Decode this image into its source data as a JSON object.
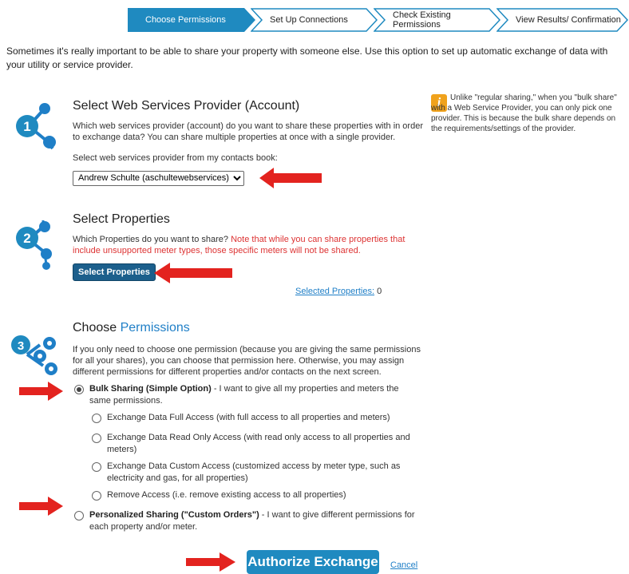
{
  "steps": [
    {
      "label": "Choose Permissions",
      "active": true
    },
    {
      "label": "Set Up Connections",
      "active": false
    },
    {
      "label": "Check Existing Permissions",
      "active": false
    },
    {
      "label": "View Results/ Confirmation",
      "active": false
    }
  ],
  "intro": "Sometimes it's really important to be able to share your property with someone else. Use this option to set up automatic exchange of data with your utility or service provider.",
  "section1": {
    "title": "Select Web Services Provider (Account)",
    "desc": "Which web services provider (account) do you want to share these properties with in order to exchange data? You can share multiple properties at once with a single provider.",
    "select_label": "Select web services provider from my contacts book:",
    "select_value": "Andrew Schulte (aschultewebservices)",
    "step_number": "1"
  },
  "note": {
    "icon": "info-icon",
    "text": "Unlike \"regular sharing,\" when you \"bulk share\" with a Web Service Provider, you can only pick one provider. This is because the bulk share depends on the requirements/settings of the provider."
  },
  "section2": {
    "title": "Select Properties",
    "desc": "Which Properties do you want to share?",
    "warning": "Note that while you can share properties that include unsupported meter types, those specific meters will not be shared.",
    "button": "Select Properties",
    "selected_label": "Selected Properties:",
    "selected_count": "0",
    "step_number": "2"
  },
  "section3": {
    "title_plain": "Choose",
    "title_accent": "Permissions",
    "desc": "If you only need to choose one permission (because you are giving the same permissions for all your shares), you can choose that permission here. Otherwise, you may assign different permissions for different properties and/or contacts on the next screen.",
    "step_number": "3",
    "bulk_bold": "Bulk Sharing (Simple Option)",
    "bulk_rest": " - I want to give all my properties and meters the same permissions.",
    "options": [
      "Exchange Data Full Access (with full access to all properties and meters)",
      "Exchange Data Read Only Access (with read only access to all properties and meters)",
      "Exchange Data Custom Access (customized access by meter type, such as electricity and gas, for all properties)",
      "Remove Access (i.e. remove existing access to all properties)"
    ],
    "personal_bold": "Personalized Sharing (\"Custom Orders\")",
    "personal_rest": " - I want to give different permissions for each property and/or meter."
  },
  "actions": {
    "authorize": "Authorize Exchange",
    "cancel": "Cancel"
  },
  "colors": {
    "accent": "#1f8ac0",
    "step_active": "#1f8ac0",
    "arrow": "#e3231f",
    "warning": "#d33333",
    "note_icon": "#f0a21c"
  }
}
